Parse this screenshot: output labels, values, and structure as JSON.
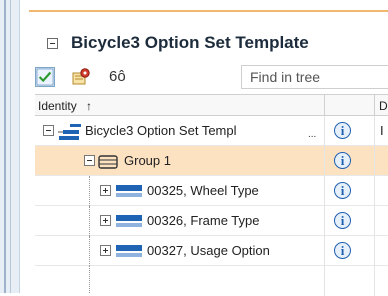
{
  "panel": {
    "title": "Bicycle3 Option Set Template"
  },
  "toolbar": {
    "find_placeholder": "Find in tree",
    "glasses_glyph": "6ô"
  },
  "grid": {
    "columns": {
      "identity": "Identity",
      "sort_arrow": "↑",
      "d": "D"
    },
    "rows": [
      {
        "label": "Bicycle3 Option Set Templ",
        "ellipsis": "...",
        "info": "i",
        "d": "I"
      },
      {
        "label": "Group 1",
        "info": "i",
        "selected": true
      },
      {
        "label": "00325, Wheel Type",
        "info": "i"
      },
      {
        "label": "00326, Frame Type",
        "info": "i"
      },
      {
        "label": "00327, Usage Option",
        "info": "i"
      }
    ]
  },
  "colors": {
    "selection": "#fde2c2",
    "accent_line": "#f0b86e",
    "info_blue": "#1f5fb0"
  }
}
